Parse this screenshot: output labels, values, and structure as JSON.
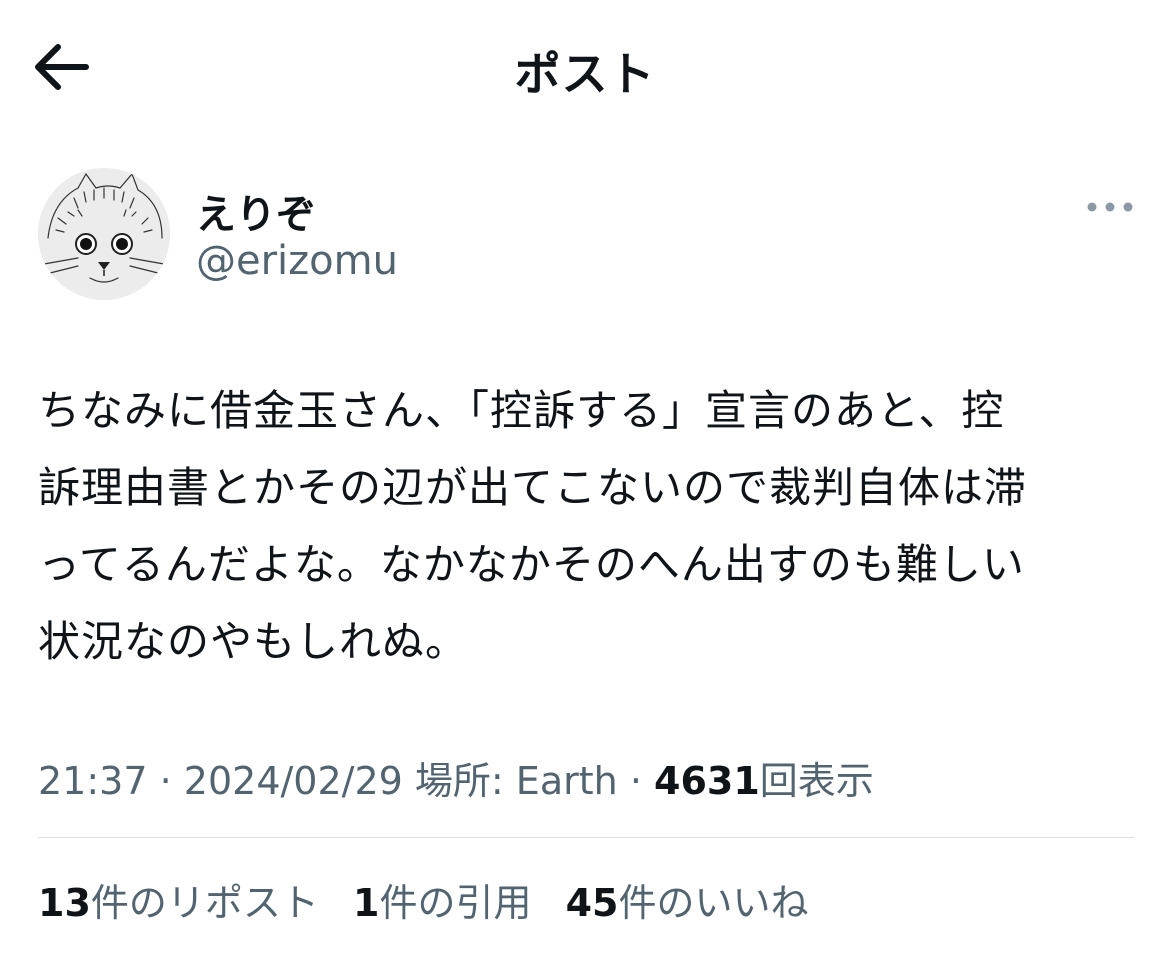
{
  "header": {
    "title": "ポスト",
    "back_icon": "arrow-left-icon"
  },
  "author": {
    "display_name": "えりぞ",
    "handle": "@erizomu",
    "avatar": "cat-sketch-avatar",
    "more_icon": "more-horizontal-icon"
  },
  "post": {
    "lines": [
      "ちなみに借金玉さん、「控訴する」宣言のあと、控",
      "訴理由書とかその辺が出てこないので裁判自体は滞",
      "ってるんだよな。なかなかそのへん出すのも難しい",
      "状況なのやもしれぬ。"
    ]
  },
  "meta": {
    "time": "21:37",
    "separator": "·",
    "date": "2024/02/29",
    "location": "場所: Earth",
    "views_count": "4631",
    "views_label": "回表示"
  },
  "stats": {
    "reposts_count": "13",
    "reposts_label": "件のリポスト",
    "quotes_count": "1",
    "quotes_label": "件の引用",
    "likes_count": "45",
    "likes_label": "件のいいね"
  },
  "colors": {
    "text_primary": "#0f1419",
    "text_secondary": "#536471",
    "divider": "#dcdfe2",
    "background": "#ffffff"
  }
}
